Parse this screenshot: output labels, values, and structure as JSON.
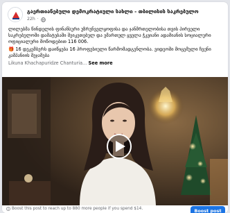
{
  "post": {
    "page_name": "გაერთიანებული დემოკრატიული სახლი - თბილისის საკრებულო",
    "time": "22h",
    "privacy_icon": "globe-icon",
    "text_line1": "ლილებმა წინდელის ფინანსური უზრუნველყოფისა და ჯანმრთელობისა თვის პირველი საკრებულოში დამატებაში შეიკეთებულ და ემართულ ყველა ჭკვიანი ადამიანის სოციალური ოფიციალური მოწოდებით 116 006.",
    "text_line2": "16 დეკემბერს დაიწყება 16 პროფესიული წარმომადგენლობა. ვიდეოში მოცემული ჩვენი კამპანიის შეჯამება",
    "author": "Likuna Khachapuridze Chanturia...",
    "see_more": "See more",
    "gift_emoji": "🎁"
  },
  "video": {
    "play_icon": "play-icon"
  },
  "footer": {
    "boost_text": "Boost this post to reach up to 880 more people if you spend $14.",
    "boost_icon": "info-icon",
    "boost_button": "Boost post"
  },
  "colors": {
    "accent": "#1b74e4",
    "secondary_text": "#65676b",
    "card_bg": "#ffffff",
    "page_bg": "#e4e6eb"
  }
}
